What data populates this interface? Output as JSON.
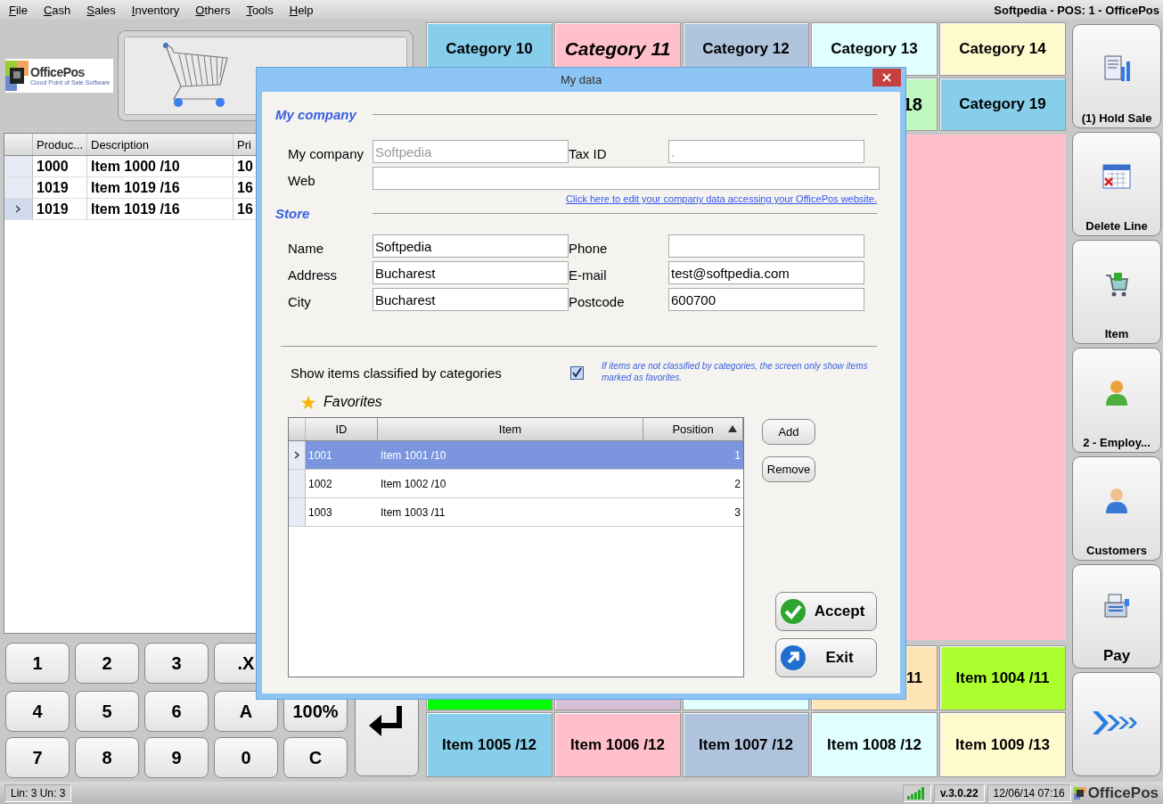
{
  "menu": [
    "File",
    "Cash",
    "Sales",
    "Inventory",
    "Others",
    "Tools",
    "Help"
  ],
  "app_title": "Softpedia - POS: 1 - OfficePos",
  "logo": {
    "name": "OfficePos",
    "tagline": "Cloud Point of Sale Software"
  },
  "sale_grid": {
    "columns": [
      "Produc...",
      "Description",
      "Pri"
    ],
    "rows": [
      {
        "cells": [
          "1000",
          "Item 1000 /10",
          "10"
        ],
        "selected": false
      },
      {
        "cells": [
          "1019",
          "Item 1019 /16",
          "16"
        ],
        "selected": false
      },
      {
        "cells": [
          "1019",
          "Item 1019 /16",
          "16"
        ],
        "selected": true
      }
    ]
  },
  "keypad": [
    [
      "1",
      "2",
      "3",
      ".X"
    ],
    [
      "4",
      "5",
      "6",
      "A",
      "100%"
    ],
    [
      "7",
      "8",
      "9",
      "0",
      "C"
    ]
  ],
  "categories": [
    {
      "label": "Category 10",
      "color": "#87ceeb",
      "selected": false
    },
    {
      "label": "Category 11",
      "color": "#ffc0cb",
      "selected": true
    },
    {
      "label": "Category 12",
      "color": "#b0c4de",
      "selected": false
    },
    {
      "label": "Category 13",
      "color": "#e0ffff",
      "selected": false
    },
    {
      "label": "Category 14",
      "color": "#fffacd",
      "selected": false
    },
    {
      "label": "18",
      "color": "#c0f8c0",
      "selected": false
    },
    {
      "label": "Category 19",
      "color": "#87ceeb",
      "selected": false
    }
  ],
  "items": [
    {
      "color": "#00ff00"
    },
    {
      "color": "#d8bfd8"
    },
    {
      "color": "#e0ffff"
    },
    {
      "label": "11",
      "color": "#ffe4b5"
    },
    {
      "label": "Item 1004 /11",
      "color": "#adff2f"
    },
    {
      "label": "Item 1005 /12",
      "color": "#87ceeb"
    },
    {
      "label": "Item 1006 /12",
      "color": "#ffc0cb"
    },
    {
      "label": "Item 1007 /12",
      "color": "#b0c4de"
    },
    {
      "label": "Item 1008 /12",
      "color": "#e0ffff"
    },
    {
      "label": "Item 1009 /13",
      "color": "#fffacd"
    }
  ],
  "actions": [
    {
      "kind": "hold",
      "label": "(1) Hold Sale"
    },
    {
      "kind": "delete",
      "label": "Delete Line"
    },
    {
      "kind": "item",
      "label": "Item"
    },
    {
      "kind": "employee",
      "label": "2 - Employ..."
    },
    {
      "kind": "customers",
      "label": "Customers"
    },
    {
      "kind": "pay",
      "label": "Pay"
    },
    {
      "kind": "next"
    }
  ],
  "status_bar": {
    "lines": "Lin: 3  Un: 3",
    "version": "v.3.0.22",
    "datetime": "12/06/14 07:16",
    "brand": "OfficePos"
  },
  "dialog": {
    "title": "My data",
    "company_section": "My company",
    "company_fields": [
      {
        "label": "My company",
        "value": "Softpedia",
        "disabled": true
      },
      {
        "label": "Tax ID",
        "value": ".",
        "disabled": true
      },
      {
        "label": "Web"
      }
    ],
    "link": "Click here to edit your company data accessing your OfficePos website.",
    "store_section": "Store",
    "store_fields": [
      {
        "label": "Name",
        "value": "Softpedia"
      },
      {
        "label": "Phone"
      },
      {
        "label": "Address",
        "value": "Bucharest"
      },
      {
        "label": "E-mail",
        "value": "test@softpedia.com"
      },
      {
        "label": "City",
        "value": "Bucharest"
      },
      {
        "label": "Postcode",
        "value": "600700"
      }
    ],
    "checkbox": {
      "label": "Show items classified by categories",
      "checked": true
    },
    "note": "If items are not classified by categories, the screen only show items marked as favorites.",
    "favorites": {
      "title": "Favorites",
      "columns": [
        "ID",
        "Item",
        "Position"
      ],
      "rows": [
        {
          "cells": [
            "1001",
            "Item 1001 /10",
            "1"
          ],
          "selected": true
        },
        {
          "cells": [
            "1002",
            "Item 1002 /10",
            "2"
          ],
          "selected": false
        },
        {
          "cells": [
            "1003",
            "Item 1003 /11",
            "3"
          ],
          "selected": false
        }
      ]
    },
    "side_buttons": [
      "Add",
      "Remove"
    ],
    "accept": "Accept",
    "exit": "Exit"
  }
}
